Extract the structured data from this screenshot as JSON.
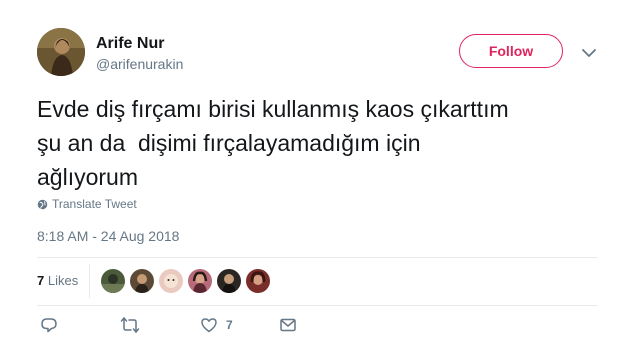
{
  "user": {
    "fullname": "Arife Nur",
    "username": "@arifenurakin"
  },
  "follow": {
    "label": "Follow"
  },
  "tweet": {
    "text": "Evde diş fırçamı birisi kullanmış kaos çıkarttım\nşu an da  dişimi fırçalayamadığım için\nağlıyorum",
    "translate_label": "Translate Tweet",
    "timestamp": "8:18 AM - 24 Aug 2018"
  },
  "stats": {
    "likes_count": "7",
    "likes_label": "Likes"
  },
  "actions": {
    "like_count": "7"
  },
  "colors": {
    "accent": "#e0245e",
    "secondary_text": "#657786",
    "primary_text": "#14171a",
    "divider": "#e6ecf0"
  },
  "icons": [
    "globe-icon",
    "chevron-down-icon",
    "reply-icon",
    "retweet-icon",
    "heart-icon",
    "envelope-icon"
  ]
}
